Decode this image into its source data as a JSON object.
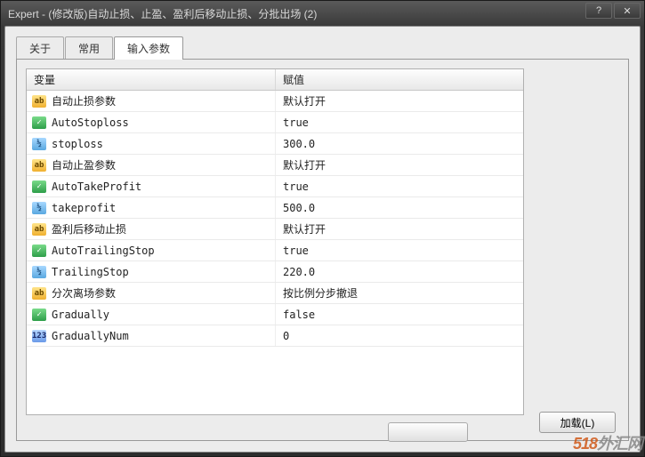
{
  "window": {
    "title": "Expert - (修改版)自动止损、止盈、盈利后移动止损、分批出场 (2)"
  },
  "tabs": {
    "about": "关于",
    "common": "常用",
    "inputs": "输入参数"
  },
  "grid": {
    "header_variable": "变量",
    "header_value": "赋值",
    "rows": [
      {
        "type": "string",
        "name": "自动止损参数",
        "value": "默认打开"
      },
      {
        "type": "bool",
        "name": "AutoStoploss",
        "value": "true"
      },
      {
        "type": "number",
        "name": "stoploss",
        "value": "300.0"
      },
      {
        "type": "string",
        "name": "自动止盈参数",
        "value": "默认打开"
      },
      {
        "type": "bool",
        "name": "AutoTakeProfit",
        "value": "true"
      },
      {
        "type": "number",
        "name": "takeprofit",
        "value": "500.0"
      },
      {
        "type": "string",
        "name": "盈利后移动止损",
        "value": "默认打开"
      },
      {
        "type": "bool",
        "name": "AutoTrailingStop",
        "value": "true"
      },
      {
        "type": "number",
        "name": "TrailingStop",
        "value": "220.0"
      },
      {
        "type": "string",
        "name": "分次离场参数",
        "value": "按比例分步撤退"
      },
      {
        "type": "bool",
        "name": "Gradually",
        "value": "false"
      },
      {
        "type": "int",
        "name": "GraduallyNum",
        "value": "0"
      }
    ]
  },
  "buttons": {
    "load": "加载(L)"
  },
  "icons": {
    "string_label": "ab",
    "bool_label": "✓",
    "number_label": "½",
    "int_label": "123"
  },
  "watermark": {
    "prefix": "518",
    "suffix": "外汇网"
  }
}
